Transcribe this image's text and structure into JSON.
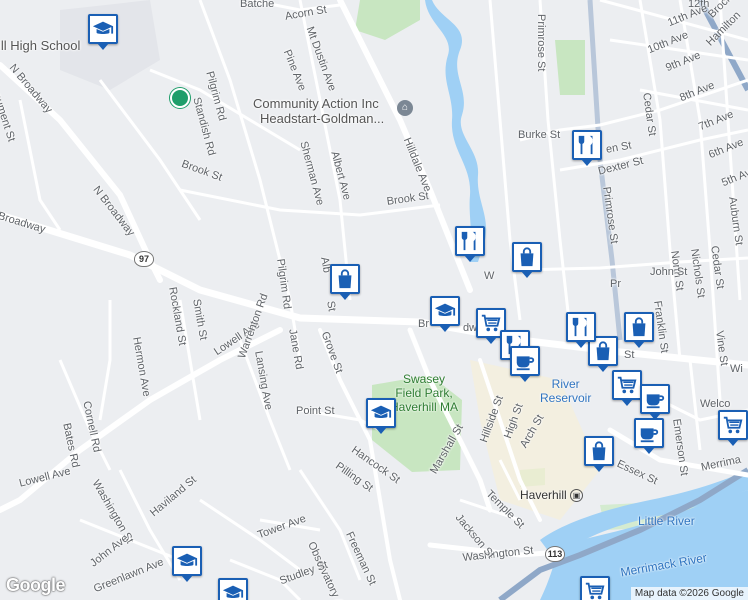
{
  "streets": {
    "acorn": "Acorn St",
    "batchelder": "Batche",
    "mt_dustin": "Mt Dustin Ave",
    "pine": "Pine Ave",
    "pilgrim_rd_n": "Pilgrim Rd",
    "standish": "Standish Rd",
    "monument": "onument St",
    "n_broadway_1": "N Broadway",
    "n_broadway_2": "N Broadway",
    "broadway_w": "Broadway",
    "sherman": "Sherman Ave",
    "albert": "Albert Ave",
    "brook_w": "Brook St",
    "brook_e": "Brook St",
    "hilldale": "Hilldale Ave",
    "primrose_n": "Primrose St",
    "primrose_s": "Primrose St",
    "primrose_s2": "Pr",
    "burke": "Burke St",
    "allen": "en St",
    "dexter": "Dexter St",
    "cedar_n": "Cedar St",
    "cedar_s": "Cedar St",
    "north_st": "North St",
    "nichols": "Nichols St",
    "auburn": "Auburn St",
    "john": "John St",
    "franklin": "Franklin St",
    "vine": "Vine St",
    "twelfth": "12th",
    "eleventh": "11th Ave",
    "tenth": "10th Ave",
    "ninth": "9th Ave",
    "eighth": "8th Ave",
    "seventh": "7th Ave",
    "sixth": "6th Ave",
    "fifth": "5th Ave",
    "brockton": "Brockto",
    "hamilton": "Hamilton",
    "pilgrim_rd_s": "Pilgrim Rd",
    "alb": "Alb",
    "st_frag": "St",
    "smith": "Smith St",
    "rockland": "Rockland St",
    "hermon": "Hermon Ave",
    "lowell_n": "Lowell Ave",
    "lowell_s": "Lowell Ave",
    "lansing": "Lansing Ave",
    "warrenton": "Warrenton Rd",
    "jane": "Jane Rd",
    "grove": "Grove St",
    "cornell": "Cornell Rd",
    "bates": "Bates Rd",
    "point": "Point St",
    "washington_w": "Washington St",
    "washington_e": "Washington St",
    "haviland": "Haviland St",
    "john_ave": "John Ave",
    "greenlawn": "Greenlawn Ave",
    "hancock": "Hancock St",
    "pilling": "Pilling St",
    "tower": "Tower Ave",
    "observatory": "Observatory Ave",
    "freeman": "Freeman St",
    "studley": "Studley St",
    "marshall": "Marshall St",
    "hillside": "Hillside St",
    "high": "High St",
    "arch": "Arch St",
    "temple": "Temple St",
    "jackson": "Jackson St",
    "emerson": "Emerson St",
    "essex": "Essex St",
    "merrimack": "Merrima",
    "welco": "Welco",
    "broadway_e": "Br",
    "broadway_e2": "dway",
    "wi": "Wi",
    "st_e": "St",
    "w_frag": "W"
  },
  "pois": {
    "high_school": "ill High School",
    "community_action_1": "Community Action Inc",
    "community_action_2": "Headstart-Goldman...",
    "swasey_1": "Swasey",
    "swasey_2": "Field Park,",
    "swasey_3": "Haverhill MA",
    "little_river_res_1": "River",
    "little_river_res_2": "Reservoir",
    "little_river": "Little River",
    "merrimack_river": "Merrimack River",
    "haverhill": "Haverhill"
  },
  "route_shields": [
    "97",
    "113"
  ],
  "markers": [
    {
      "icon": "school-icon"
    },
    {
      "icon": "shopping-bag-icon"
    },
    {
      "icon": "restaurant-icon"
    },
    {
      "icon": "restaurant-icon"
    },
    {
      "icon": "shopping-bag-icon"
    },
    {
      "icon": "school-icon"
    },
    {
      "icon": "shopping-cart-icon"
    },
    {
      "icon": "restaurant-icon"
    },
    {
      "icon": "cafe-icon"
    },
    {
      "icon": "shopping-bag-icon"
    },
    {
      "icon": "restaurant-icon"
    },
    {
      "icon": "shopping-bag-icon"
    },
    {
      "icon": "shopping-cart-icon"
    },
    {
      "icon": "cafe-icon"
    },
    {
      "icon": "cafe-icon"
    },
    {
      "icon": "shopping-bag-icon"
    },
    {
      "icon": "school-icon"
    },
    {
      "icon": "school-icon"
    },
    {
      "icon": "school-icon"
    },
    {
      "icon": "shopping-cart-icon"
    },
    {
      "icon": "shopping-cart-icon"
    }
  ],
  "attribution": {
    "logo": "Google",
    "text": "Map data ©2026 Google"
  },
  "colors": {
    "marker_border": "#1a5fb4",
    "water": "#9fd0f5",
    "park": "#c8e6c1",
    "highway": "#8fa8c8"
  }
}
